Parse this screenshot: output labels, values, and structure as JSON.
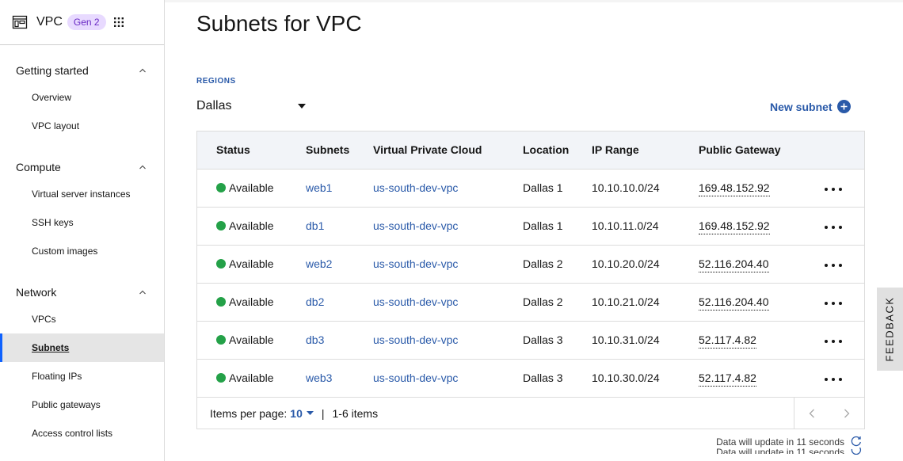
{
  "header": {
    "app_title": "VPC",
    "gen_badge": "Gen 2"
  },
  "sidebar": {
    "sections": [
      {
        "label": "Getting started",
        "items": [
          "Overview",
          "VPC layout"
        ]
      },
      {
        "label": "Compute",
        "items": [
          "Virtual server instances",
          "SSH keys",
          "Custom images"
        ]
      },
      {
        "label": "Network",
        "items": [
          "VPCs",
          "Subnets",
          "Floating IPs",
          "Public gateways",
          "Access control lists"
        ]
      }
    ],
    "active_item": "Subnets"
  },
  "main": {
    "title": "Subnets for VPC",
    "regions_label": "REGIONS",
    "region_value": "Dallas",
    "new_subnet_label": "New subnet"
  },
  "table": {
    "headers": [
      "Status",
      "Subnets",
      "Virtual Private Cloud",
      "Location",
      "IP Range",
      "Public Gateway"
    ],
    "rows": [
      {
        "status": "Available",
        "subnet": "web1",
        "vpc": "us-south-dev-vpc",
        "location": "Dallas 1",
        "ip_range": "10.10.10.0/24",
        "gateway": "169.48.152.92"
      },
      {
        "status": "Available",
        "subnet": "db1",
        "vpc": "us-south-dev-vpc",
        "location": "Dallas 1",
        "ip_range": "10.10.11.0/24",
        "gateway": "169.48.152.92"
      },
      {
        "status": "Available",
        "subnet": "web2",
        "vpc": "us-south-dev-vpc",
        "location": "Dallas 2",
        "ip_range": "10.10.20.0/24",
        "gateway": "52.116.204.40"
      },
      {
        "status": "Available",
        "subnet": "db2",
        "vpc": "us-south-dev-vpc",
        "location": "Dallas 2",
        "ip_range": "10.10.21.0/24",
        "gateway": "52.116.204.40"
      },
      {
        "status": "Available",
        "subnet": "db3",
        "vpc": "us-south-dev-vpc",
        "location": "Dallas 3",
        "ip_range": "10.10.31.0/24",
        "gateway": "52.117.4.82"
      },
      {
        "status": "Available",
        "subnet": "web3",
        "vpc": "us-south-dev-vpc",
        "location": "Dallas 3",
        "ip_range": "10.10.30.0/24",
        "gateway": "52.117.4.82"
      }
    ]
  },
  "pagination": {
    "items_per_page_label": "Items per page:",
    "items_per_page_value": "10",
    "separator": "|",
    "range_text": "1-6 items"
  },
  "status": {
    "update_text": "Data will update in 11 seconds"
  },
  "feedback_label": "FEEDBACK",
  "colors": {
    "accent": "#2a5aa9",
    "status_available": "#24a148",
    "badge_bg": "#e8daff",
    "badge_text": "#6929c4"
  },
  "icons": [
    "vpc-icon",
    "app-grid-icon",
    "chevron-up-icon",
    "caret-down-icon",
    "add-circle-icon",
    "overflow-menu-icon",
    "chevron-left-icon",
    "chevron-right-icon",
    "refresh-icon"
  ]
}
